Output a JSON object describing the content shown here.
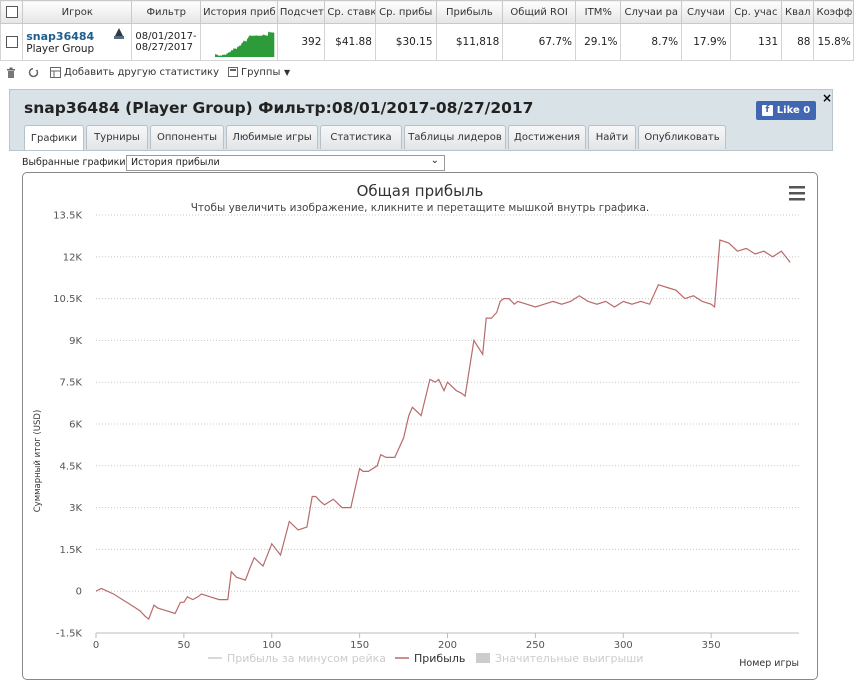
{
  "table": {
    "headers": [
      "",
      "Игрок",
      "Фильтр",
      "История приб",
      "Подсчет",
      "Ср. ставк",
      "Ср. прибы",
      "Прибыль",
      "Общий ROI",
      "ITM%",
      "Случаи ра",
      "Случаи",
      "Ср. учас",
      "Квал",
      "Коэфф"
    ],
    "row": {
      "player": "snap36484",
      "network": "Player Group",
      "filter_from": "08/01/2017-",
      "filter_to": "08/27/2017",
      "count": "392",
      "avg_stake": "$41.88",
      "avg_profit": "$30.15",
      "profit": "$11,818",
      "roi": "67.7%",
      "itm": "29.1%",
      "cases_a": "8.7%",
      "cases_b": "17.9%",
      "avg_field": "131",
      "qual": "88",
      "coef": "15.8%"
    }
  },
  "toolbar": {
    "add_stat": "Добавить другую статистику",
    "groups": "Группы"
  },
  "panel": {
    "title": "snap36484 (Player Group) Фильтр:08/01/2017-08/27/2017",
    "fb_like": "Like 0",
    "close": "×",
    "tabs": [
      "Графики",
      "Турниры",
      "Оппоненты",
      "Любимые игры",
      "Статистика",
      "Таблицы лидеров",
      "Достижения",
      "Найти",
      "Опубликовать"
    ]
  },
  "chart_select": {
    "label": "Выбранные графики:",
    "value": "История прибыли"
  },
  "colors": {
    "line": "#b96a6a",
    "grid": "#c8c8c8",
    "sparkline": "#2e9b3a"
  },
  "chart_data": {
    "type": "line",
    "title": "Общая прибыль",
    "subtitle": "Чтобы увеличить изображение, кликните и перетащите мышкой внутрь графика.",
    "xlabel": "Номер игры",
    "ylabel": "Суммарный итог (USD)",
    "xlim": [
      0,
      400
    ],
    "ylim": [
      -1500,
      13500
    ],
    "x_ticks": [
      0,
      50,
      100,
      150,
      200,
      250,
      300,
      350
    ],
    "y_ticks": [
      -1500,
      0,
      1500,
      3000,
      4500,
      6000,
      7500,
      9000,
      10500,
      12000,
      13500
    ],
    "y_tick_labels": [
      "-1.5K",
      "0",
      "1.5K",
      "3K",
      "4.5K",
      "6K",
      "7.5K",
      "9K",
      "10.5K",
      "12K",
      "13.5K"
    ],
    "grid": true,
    "legend": [
      {
        "name": "Прибыль за минусом рейка",
        "visible": false
      },
      {
        "name": "Прибыль",
        "visible": true
      },
      {
        "name": "Значительные выигрыши",
        "visible": false
      }
    ],
    "series": [
      {
        "name": "Прибыль",
        "x": [
          0,
          3,
          10,
          15,
          20,
          25,
          28,
          30,
          33,
          35,
          40,
          45,
          48,
          50,
          52,
          55,
          58,
          60,
          65,
          70,
          75,
          77,
          80,
          85,
          88,
          90,
          95,
          100,
          105,
          110,
          115,
          120,
          123,
          125,
          128,
          130,
          135,
          140,
          145,
          150,
          152,
          155,
          160,
          162,
          165,
          170,
          175,
          178,
          180,
          185,
          190,
          193,
          195,
          198,
          200,
          205,
          208,
          210,
          215,
          220,
          222,
          225,
          228,
          230,
          232,
          235,
          238,
          240,
          245,
          250,
          255,
          260,
          265,
          270,
          275,
          280,
          285,
          290,
          295,
          300,
          305,
          310,
          315,
          320,
          325,
          330,
          335,
          340,
          345,
          350,
          352,
          355,
          360,
          365,
          370,
          375,
          380,
          385,
          390,
          395
        ],
        "values": [
          0,
          100,
          -100,
          -300,
          -500,
          -700,
          -900,
          -1000,
          -500,
          -600,
          -700,
          -800,
          -400,
          -400,
          -200,
          -300,
          -200,
          -100,
          -200,
          -300,
          -300,
          700,
          500,
          400,
          900,
          1200,
          900,
          1700,
          1300,
          2500,
          2200,
          2300,
          3400,
          3400,
          3200,
          3100,
          3300,
          3000,
          3000,
          4400,
          4300,
          4300,
          4500,
          4900,
          4800,
          4800,
          5500,
          6300,
          6600,
          6300,
          7600,
          7500,
          7600,
          7200,
          7500,
          7200,
          7100,
          7000,
          9000,
          8500,
          9800,
          9800,
          10000,
          10400,
          10500,
          10500,
          10300,
          10400,
          10300,
          10200,
          10300,
          10400,
          10300,
          10400,
          10600,
          10400,
          10300,
          10400,
          10200,
          10400,
          10300,
          10400,
          10300,
          11000,
          10900,
          10800,
          10500,
          10600,
          10400,
          10300,
          10200,
          12600,
          12500,
          12200,
          12300,
          12100,
          12200,
          12000,
          12200,
          11800
        ]
      }
    ]
  }
}
